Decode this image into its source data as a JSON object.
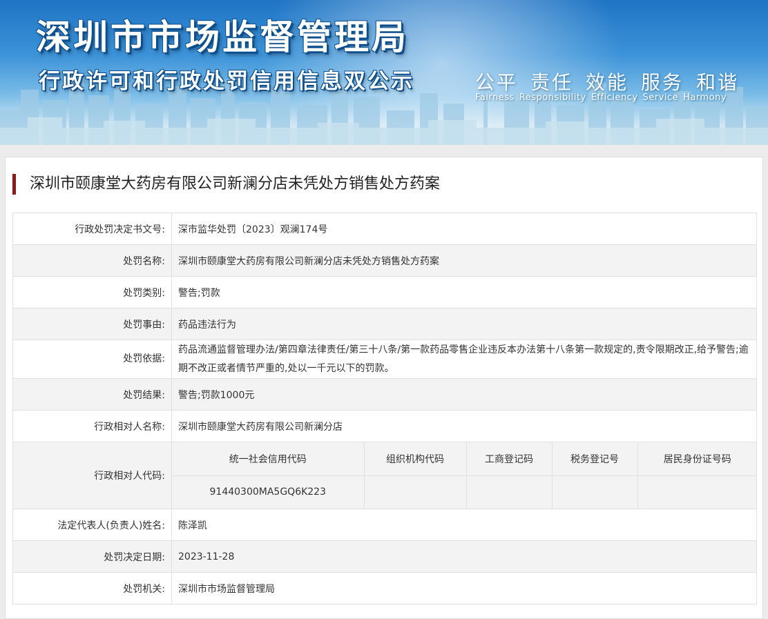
{
  "banner": {
    "title": "深圳市市场监督管理局",
    "subtitle": "行政许可和行政处罚信用信息双公示",
    "slogans": [
      {
        "cn": "公平",
        "en": "Fairness"
      },
      {
        "cn": "责任",
        "en": "Responsibility"
      },
      {
        "cn": "效能",
        "en": "Efficiency"
      },
      {
        "cn": "服务",
        "en": "Service"
      },
      {
        "cn": "和谐",
        "en": "Harmony"
      }
    ]
  },
  "case_title": "深圳市颐康堂大药房有限公司新澜分店未凭处方销售处方药案",
  "fields": {
    "decision_no": {
      "label": "行政处罚决定书文号:",
      "value": "深市监华处罚〔2023〕观澜174号"
    },
    "penalty_name": {
      "label": "处罚名称:",
      "value": "深圳市颐康堂大药房有限公司新澜分店未凭处方销售处方药案"
    },
    "penalty_type": {
      "label": "处罚类别:",
      "value": "警告;罚款"
    },
    "penalty_reason": {
      "label": "处罚事由:",
      "value": "药品违法行为"
    },
    "penalty_basis": {
      "label": "处罚依据:",
      "value": "药品流通监督管理办法/第四章法律责任/第三十八条/第一款药品零售企业违反本办法第十八条第一款规定的,责令限期改正,给予警告;逾期不改正或者情节严重的,处以一千元以下的罚款。"
    },
    "penalty_result": {
      "label": "处罚结果:",
      "value": "警告;罚款1000元"
    },
    "party_name": {
      "label": "行政相对人名称:",
      "value": "深圳市颐康堂大药房有限公司新澜分店"
    },
    "party_code": {
      "label": "行政相对人代码:",
      "headers": [
        "统一社会信用代码",
        "组织机构代码",
        "工商登记码",
        "税务登记号",
        "居民身份证号码"
      ],
      "values": [
        "91440300MA5GQ6K223",
        "",
        "",
        "",
        ""
      ]
    },
    "legal_rep": {
      "label": "法定代表人(负责人)姓名:",
      "value": "陈泽凯"
    },
    "decision_date": {
      "label": "处罚决定日期:",
      "value": "2023-11-28"
    },
    "authority": {
      "label": "处罚机关:",
      "value": "深圳市市场监督管理局"
    }
  },
  "colors": {
    "title_bar": "#8c1a1a",
    "banner_blue": "#1f74c4",
    "row_alt": "#f3f3f3"
  }
}
